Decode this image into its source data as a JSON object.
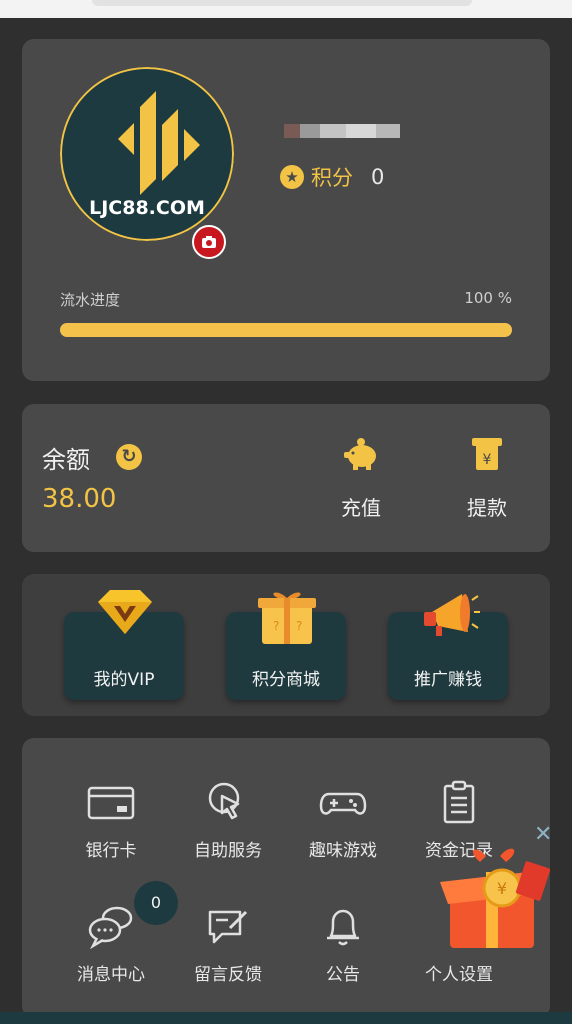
{
  "profile": {
    "avatar_text": "LJC88.COM",
    "points_label": "积分",
    "points_value": "0",
    "progress_label": "流水进度",
    "progress_percent_text": "100 %",
    "progress_fraction": 1.0
  },
  "balance": {
    "label": "余额",
    "value": "38.00",
    "deposit_label": "充值",
    "withdraw_label": "提款"
  },
  "shortcuts": [
    {
      "label": "我的VIP",
      "icon": "vip-diamond-icon"
    },
    {
      "label": "积分商城",
      "icon": "gift-box-icon"
    },
    {
      "label": "推广赚钱",
      "icon": "megaphone-icon"
    }
  ],
  "menu": [
    {
      "label": "银行卡",
      "icon": "bank-card-icon"
    },
    {
      "label": "自助服务",
      "icon": "pointer-click-icon"
    },
    {
      "label": "趣味游戏",
      "icon": "gamepad-icon"
    },
    {
      "label": "资金记录",
      "icon": "clipboard-icon"
    },
    {
      "label": "消息中心",
      "icon": "chat-bubbles-icon"
    },
    {
      "label": "留言反馈",
      "icon": "feedback-edit-icon"
    },
    {
      "label": "公告",
      "icon": "bell-icon"
    },
    {
      "label": "个人设置",
      "icon": "settings-icon"
    }
  ],
  "message_badge": "0",
  "colors": {
    "accent_gold": "#f2c345",
    "card_bg": "#494949",
    "page_bg": "#2f2f2f",
    "teal": "#1d3a40",
    "camera_red": "#c7181f"
  }
}
